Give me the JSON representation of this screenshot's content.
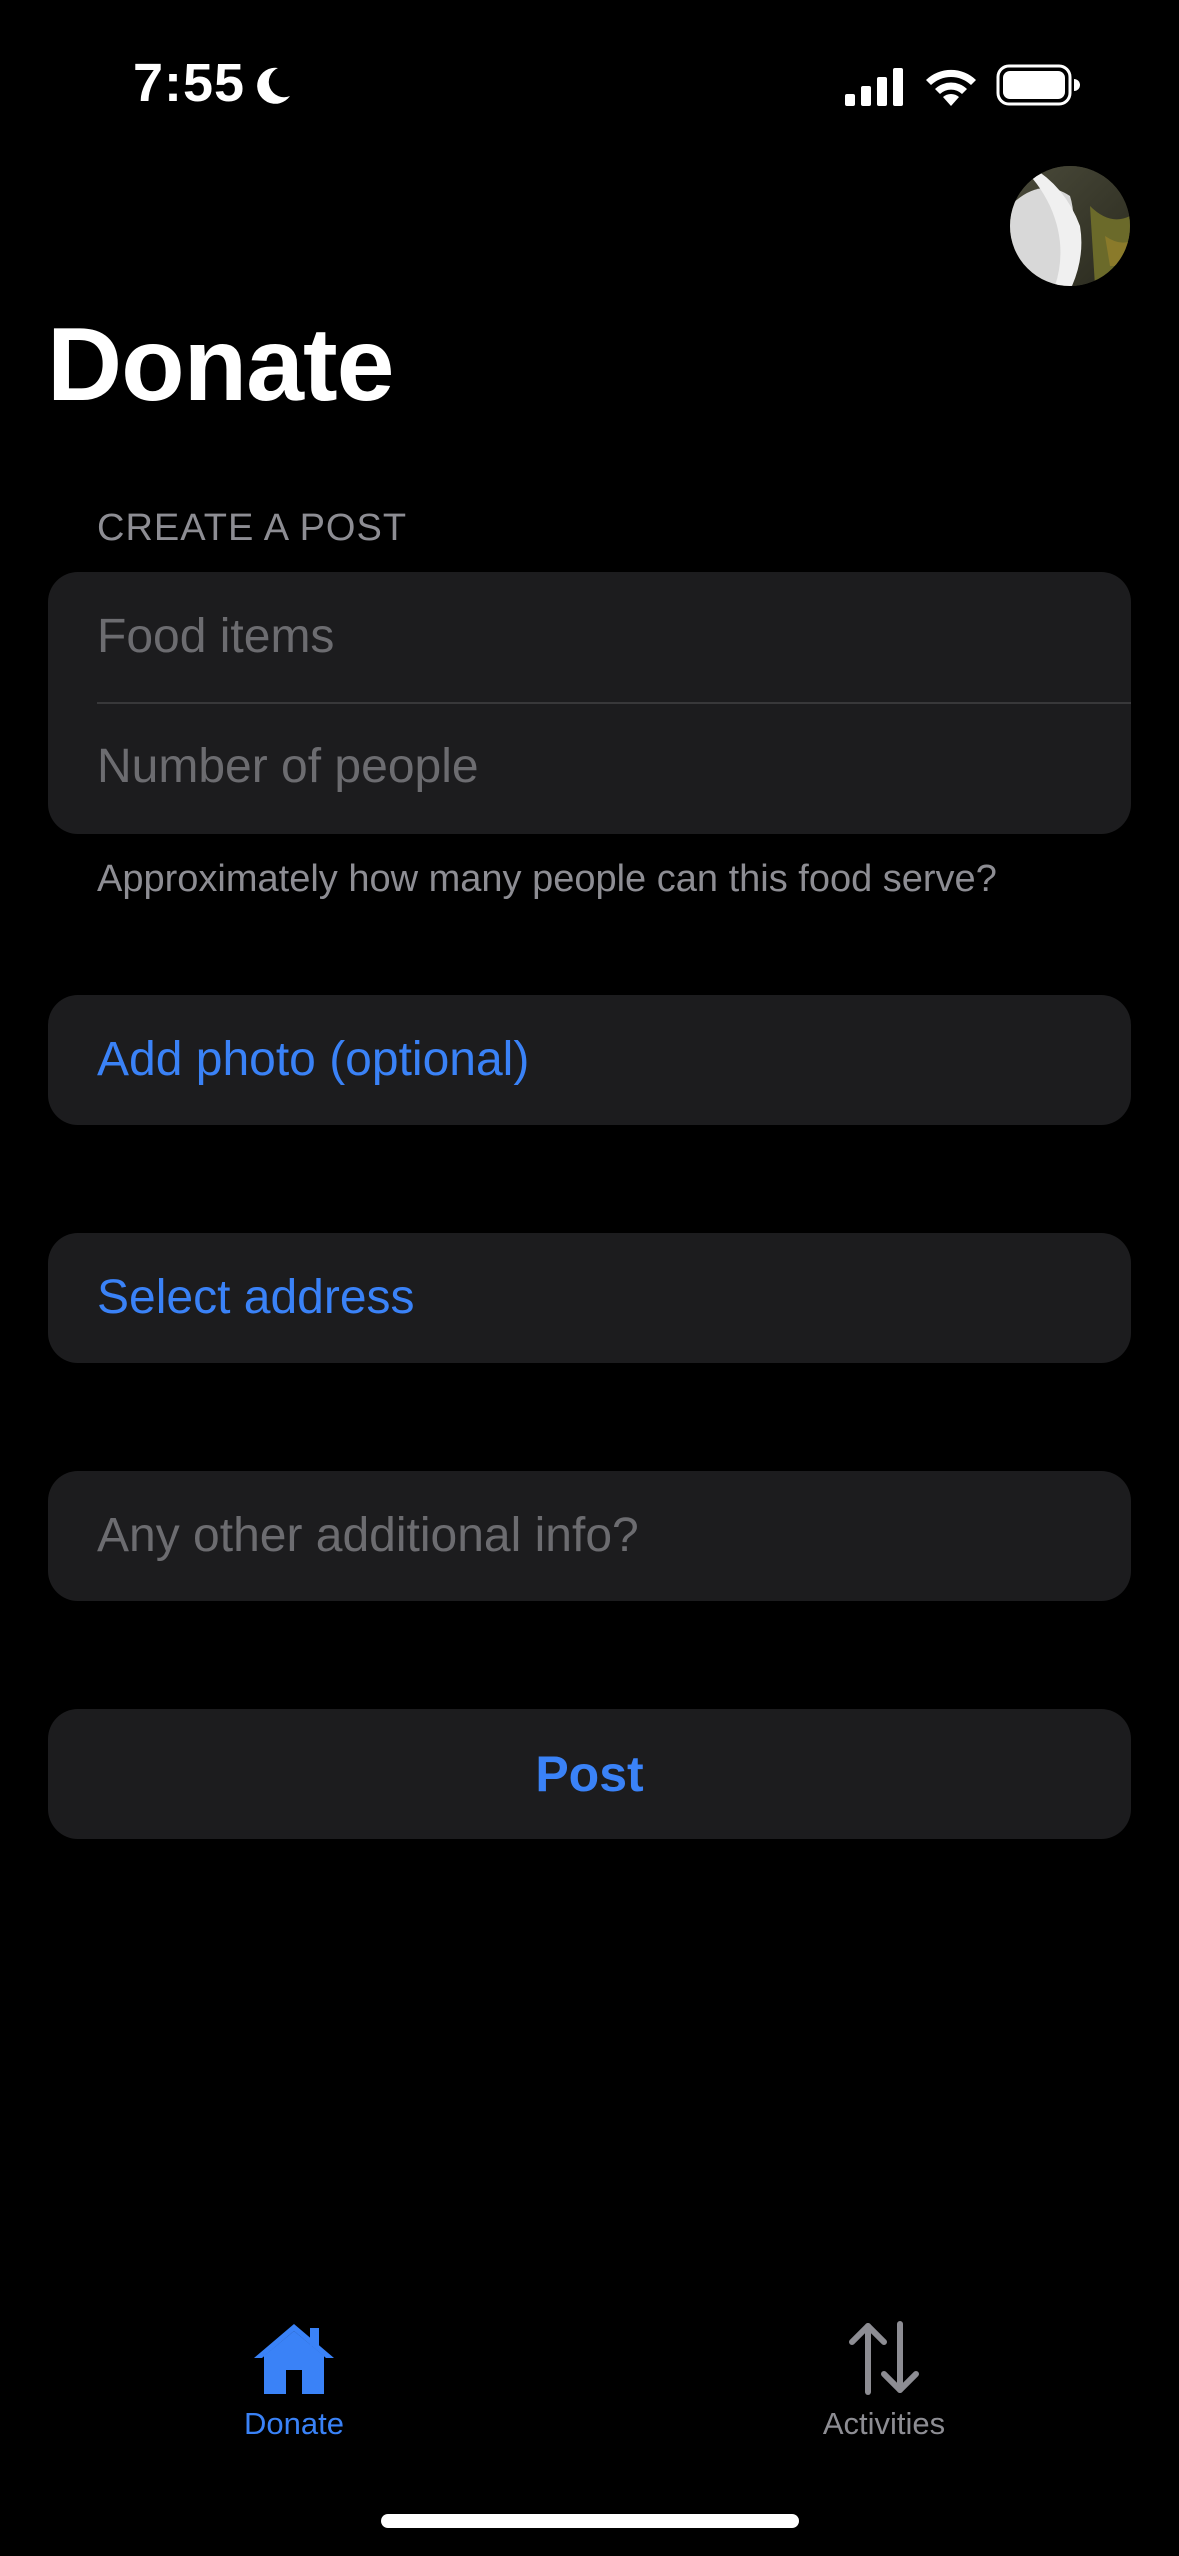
{
  "status_bar": {
    "time": "7:55",
    "icons": [
      "moon-icon",
      "signal-icon",
      "wifi-icon",
      "battery-icon"
    ]
  },
  "header": {
    "title": "Donate",
    "avatar_icon": "profile-avatar"
  },
  "form": {
    "section_header": "CREATE A POST",
    "food_items_placeholder": "Food items",
    "people_placeholder": "Number of people",
    "people_footer": "Approximately how many people can this food serve?",
    "add_photo_label": "Add photo (optional)",
    "select_address_label": "Select address",
    "additional_info_placeholder": "Any other additional info?",
    "post_label": "Post"
  },
  "tab_bar": {
    "tabs": [
      {
        "label": "Donate",
        "icon": "house-icon",
        "selected": true
      },
      {
        "label": "Activities",
        "icon": "arrows-up-down-icon",
        "selected": false
      }
    ]
  },
  "colors": {
    "background": "#000000",
    "card": "#1c1c1e",
    "accent": "#3a82f7",
    "placeholder": "#6c6c70",
    "secondary_text": "#8d8d93"
  }
}
